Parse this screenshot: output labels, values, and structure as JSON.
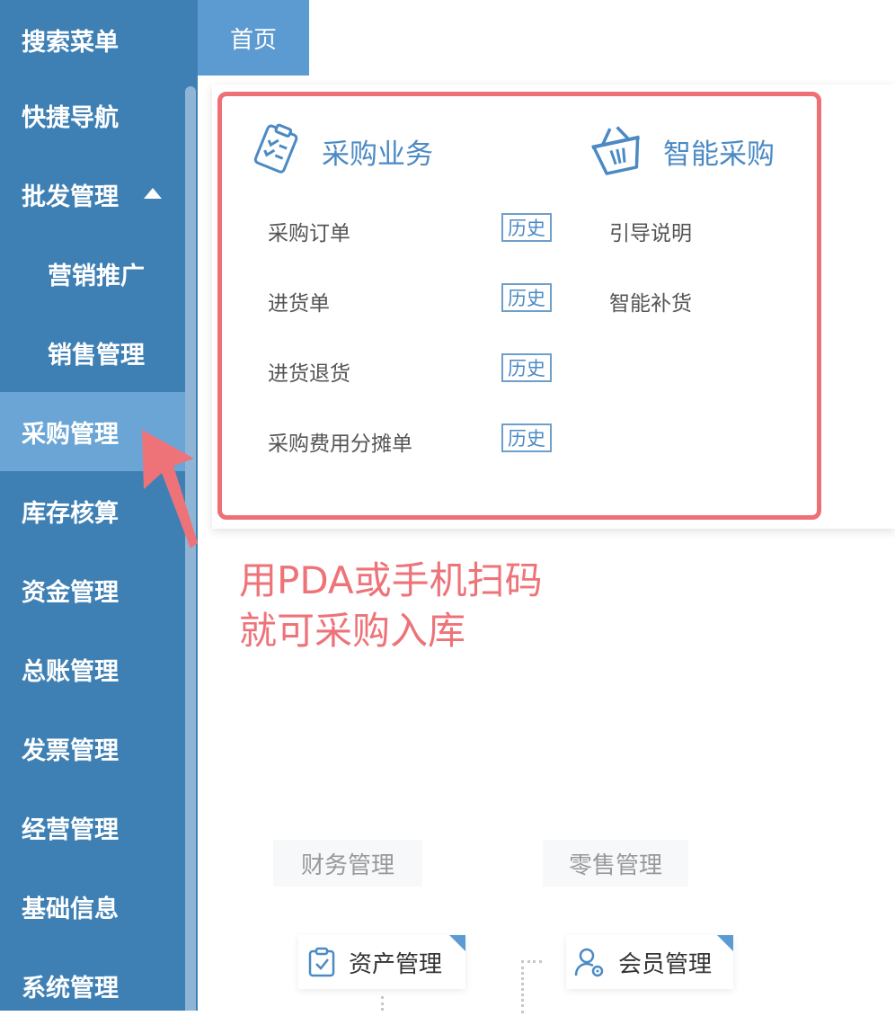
{
  "sidebar": {
    "items": [
      {
        "label": "搜索菜单"
      },
      {
        "label": "快捷导航"
      },
      {
        "label": "批发管理"
      },
      {
        "label": "营销推广"
      },
      {
        "label": "销售管理"
      },
      {
        "label": "采购管理"
      },
      {
        "label": "库存核算"
      },
      {
        "label": "资金管理"
      },
      {
        "label": "总账管理"
      },
      {
        "label": "发票管理"
      },
      {
        "label": "经营管理"
      },
      {
        "label": "基础信息"
      },
      {
        "label": "系统管理"
      }
    ]
  },
  "tabs": {
    "home": "首页"
  },
  "panel": {
    "purchase_title": "采购业务",
    "smart_title": "智能采购",
    "purchase_items": [
      {
        "label": "采购订单",
        "history": "历史"
      },
      {
        "label": "进货单",
        "history": "历史"
      },
      {
        "label": "进货退货",
        "history": "历史"
      },
      {
        "label": "采购费用分摊单",
        "history": "历史"
      }
    ],
    "smart_items": [
      {
        "label": "引导说明"
      },
      {
        "label": "智能补货"
      }
    ]
  },
  "annotation": {
    "line1": "用PDA或手机扫码",
    "line2": "就可采购入库"
  },
  "background": {
    "finance_tab": "财务管理",
    "retail_tab": "零售管理",
    "asset_card": "资产管理",
    "member_card": "会员管理"
  },
  "colors": {
    "sidebar_bg": "#3f80b4",
    "sidebar_active": "#6aa5d6",
    "accent": "#4b8ac4",
    "highlight": "#ef6f76"
  }
}
